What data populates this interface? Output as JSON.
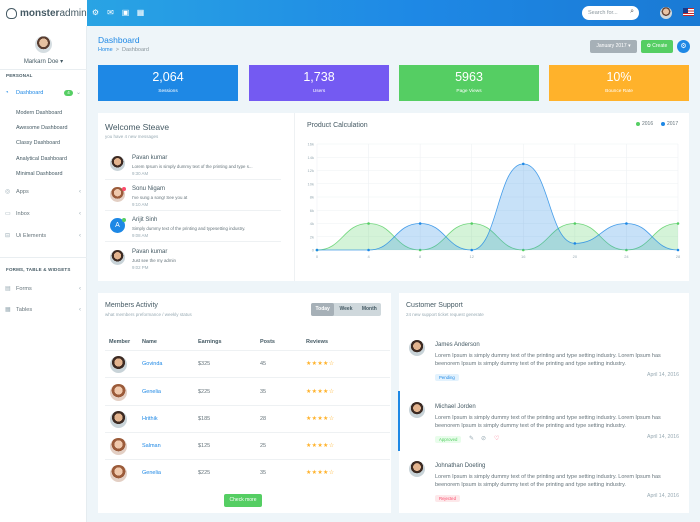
{
  "app": {
    "logo_bold": "monster",
    "logo_light": "admin"
  },
  "topbar": {
    "search_placeholder": "Search for...",
    "icons": [
      "settings-icon",
      "comment-icon",
      "mail-icon",
      "grid-icon"
    ]
  },
  "sidebar": {
    "user_name": "Markarn Doe ▾",
    "section_personal": "PERSONAL",
    "dashboard": {
      "label": "Dashboard",
      "badge": "4"
    },
    "sub_items": [
      "Modern Dashboard",
      "Awesome Dashboard",
      "Classy Dashboard",
      "Analytical Dashboard",
      "Minimal Dashboard"
    ],
    "items": [
      "Apps",
      "Inbox",
      "Ui Elements"
    ],
    "section_forms": "FORMS, TABLE & WIDGETS",
    "items2": [
      "Forms",
      "Tables"
    ]
  },
  "page": {
    "title": "Dashboard",
    "breadcrumb_home": "Home",
    "breadcrumb_current": "Dashboard",
    "month_button": "January 2017 ▾",
    "create_button": "✿ Create"
  },
  "stats": [
    {
      "value": "2,064",
      "label": "Sessions",
      "color": "#1e88e5"
    },
    {
      "value": "1,738",
      "label": "Users",
      "color": "#745af2"
    },
    {
      "value": "5963",
      "label": "Page Views",
      "color": "#55ce63"
    },
    {
      "value": "10%",
      "label": "Bounce Rate",
      "color": "#ffb22b"
    }
  ],
  "welcome": {
    "title": "Welcome Steave",
    "subtitle": "you have 4 new messages",
    "messages": [
      {
        "name": "Pavan kumar",
        "text": "Lorem Ipsum is simply dummy text of the printing and type s...",
        "time": "9:30 AM"
      },
      {
        "name": "Sonu Nigam",
        "text": "I've sung a song! See you at",
        "time": "9:10 AM"
      },
      {
        "name": "Arijit Sinh",
        "text": "Simply dummy text of the printing and typesetting industry.",
        "time": "9:08 AM",
        "initial": "A"
      },
      {
        "name": "Pavan kumar",
        "text": "Just see the my admin",
        "time": "9:02 PM"
      }
    ]
  },
  "chart_panel": {
    "title": "Product Calculation"
  },
  "chart_data": {
    "type": "area",
    "legend": [
      "2016",
      "2017"
    ],
    "legend_position": "top-right",
    "colors": {
      "2016": "#55ce63",
      "2017": "#1e88e5"
    },
    "x": [
      0,
      4,
      8,
      12,
      16,
      20,
      24,
      28
    ],
    "xticks": [
      "0",
      "4",
      "8",
      "12",
      "16",
      "20",
      "24",
      "28"
    ],
    "yticks": [
      "0",
      "2k",
      "4k",
      "6k",
      "8k",
      "10k",
      "12k",
      "14k",
      "16k"
    ],
    "ylim": [
      0,
      16
    ],
    "series": [
      {
        "name": "2016",
        "values": [
          0,
          4,
          0,
          4,
          0,
          4,
          0,
          4
        ]
      },
      {
        "name": "2017",
        "values": [
          0,
          0,
          4,
          0,
          13,
          1,
          4,
          0
        ]
      }
    ],
    "grid": true
  },
  "members": {
    "title": "Members Activity",
    "subtitle": "what members preformance / weekly status",
    "tabs": [
      "Today",
      "Week",
      "Month"
    ],
    "headers": [
      "Member",
      "Name",
      "Earnings",
      "Posts",
      "Reviews"
    ],
    "rows": [
      {
        "name": "Govinda",
        "earnings": "$325",
        "posts": "45",
        "stars": "★★★★☆"
      },
      {
        "name": "Genelia",
        "earnings": "$225",
        "posts": "35",
        "stars": "★★★★☆"
      },
      {
        "name": "Hrithik",
        "earnings": "$185",
        "posts": "28",
        "stars": "★★★★☆"
      },
      {
        "name": "Salman",
        "earnings": "$125",
        "posts": "25",
        "stars": "★★★★☆"
      },
      {
        "name": "Genelia",
        "earnings": "$225",
        "posts": "35",
        "stars": "★★★★☆"
      }
    ],
    "check_more": "Check more"
  },
  "support": {
    "title": "Customer Support",
    "subtitle": "24 new support ticket request generate",
    "tickets": [
      {
        "name": "James Anderson",
        "text": "Lorem Ipsum is simply dummy text of the printing and type setting industry. Lorem Ipsum has beenorem Ipsum is simply dummy text of the printing and type setting industry.",
        "status": "Pending",
        "date": "April 14, 2016",
        "status_color": "#e3f2fd",
        "status_text": "#1e88e5"
      },
      {
        "name": "Michael Jorden",
        "text": "Lorem Ipsum is simply dummy text of the printing and type setting industry. Lorem Ipsum has beenorem Ipsum is simply dummy text of the printing and type setting industry.",
        "status": "Approved",
        "date": "April 14, 2016",
        "status_color": "#e8fdeb",
        "status_text": "#55ce63"
      },
      {
        "name": "Johnathan Doeting",
        "text": "Lorem Ipsum is simply dummy text of the printing and type setting industry. Lorem Ipsum has beenorem Ipsum is simply dummy text of the printing and type setting industry.",
        "status": "Rejected",
        "date": "April 14, 2016",
        "status_color": "#fde8ea",
        "status_text": "#fc4b6c"
      }
    ]
  }
}
